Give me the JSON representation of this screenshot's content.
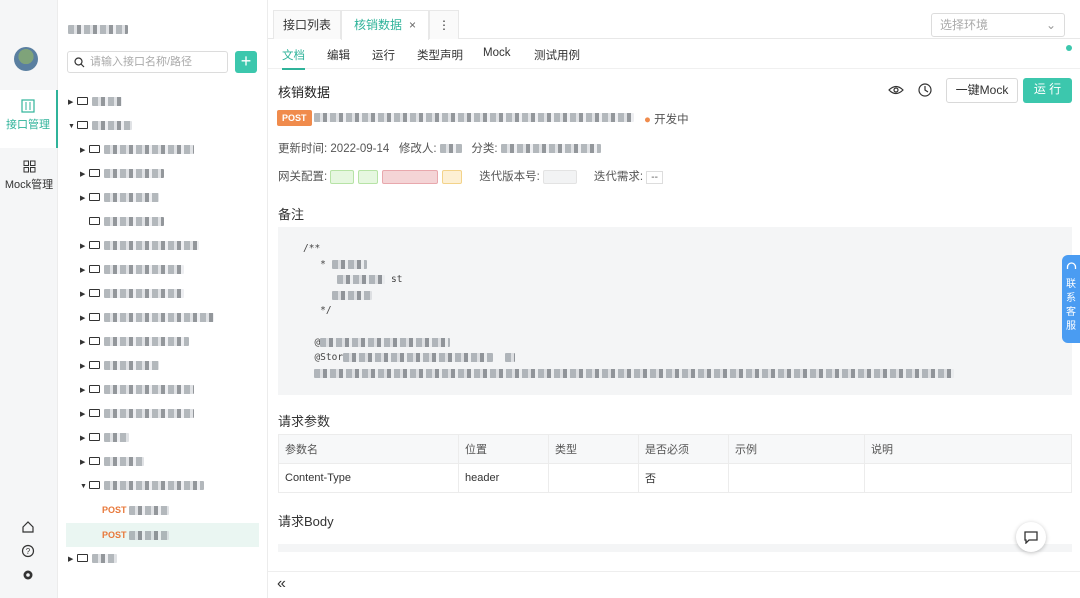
{
  "rail": {
    "nav_api": "接口管理",
    "nav_mock": "Mock管理"
  },
  "tree": {
    "search_placeholder": "请输入接口名称/路径",
    "add_label": "+",
    "items": [
      {
        "method": "POST"
      },
      {
        "method": "POST"
      }
    ]
  },
  "tabs": {
    "list": "接口列表",
    "active": "核销数据",
    "close": "×",
    "more": "⋮"
  },
  "env": {
    "placeholder": "选择环境"
  },
  "subtabs": [
    "文档",
    "编辑",
    "运行",
    "类型声明",
    "Mock",
    "测试用例"
  ],
  "doc": {
    "title": "核销数据",
    "method": "POST",
    "status": "开发中",
    "updated_label": "更新时间:",
    "updated": "2022-09-14",
    "modifier_label": "修改人:",
    "category_label": "分类:",
    "gateway_label": "网关配置:",
    "iter_version_label": "迭代版本号:",
    "iter_req_label": "迭代需求:",
    "iter_req_value": "--",
    "mock_btn": "一键Mock",
    "run_btn": "运 行"
  },
  "notes": {
    "heading": "备注",
    "code_lines": [
      "/**",
      "   * ",
      "      ",
      "     ",
      "   */",
      " ",
      "  @",
      "  @Stor",
      "  "
    ]
  },
  "params": {
    "heading": "请求参数",
    "columns": [
      "参数名",
      "位置",
      "类型",
      "是否必须",
      "示例",
      "说明"
    ],
    "rows": [
      [
        "Content-Type",
        "header",
        "",
        "否",
        "",
        ""
      ]
    ]
  },
  "body": {
    "heading": "请求Body"
  },
  "footer": {
    "collapse": "«"
  },
  "support": {
    "label": "联系客服"
  },
  "colors": {
    "accent": "#2fb39a",
    "post": "#f08b4c",
    "status": "#f08b4c"
  }
}
